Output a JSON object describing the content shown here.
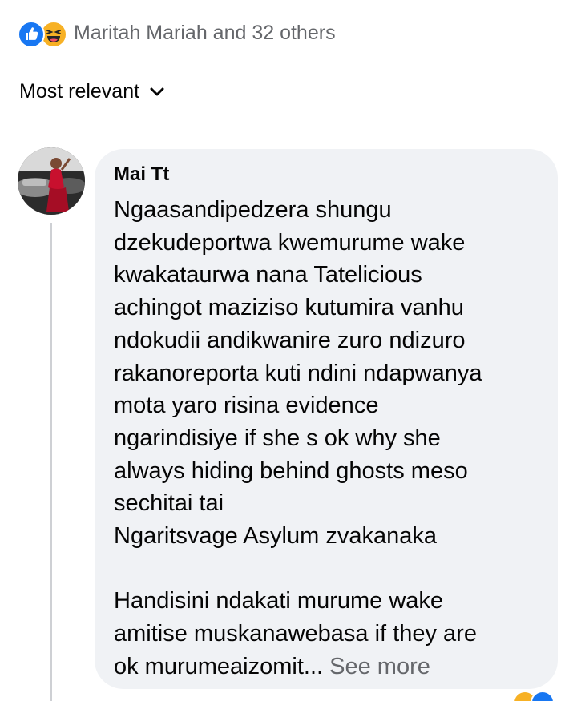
{
  "reactions": {
    "summary_text": "Maritah Mariah and 32 others",
    "icons": [
      "like-icon",
      "haha-icon"
    ],
    "colors": {
      "like": "#1877f2",
      "haha": "#f7b125"
    }
  },
  "sort": {
    "label": "Most relevant"
  },
  "comment": {
    "author": "Mai Tt",
    "lines": [
      "Ngaasandipedzera shungu",
      "dzekudeportwa kwemurume wake",
      "kwakataurwa nana Tatelicious",
      "achingot maziziso kutumira vanhu",
      "ndokudii andikwanire zuro ndizuro",
      "rakanoreporta kuti ndini ndapwanya",
      "mota yaro risina evidence",
      "ngarindisiye if she s ok why she",
      "always hiding behind ghosts meso",
      "sechitai tai",
      "Ngaritsvage Asylum zvakanaka",
      "",
      "Handisini ndakati murume wake",
      "amitise muskanawebasa if they are"
    ],
    "last_line": "ok murumeaizomit...",
    "see_more": "See more"
  }
}
